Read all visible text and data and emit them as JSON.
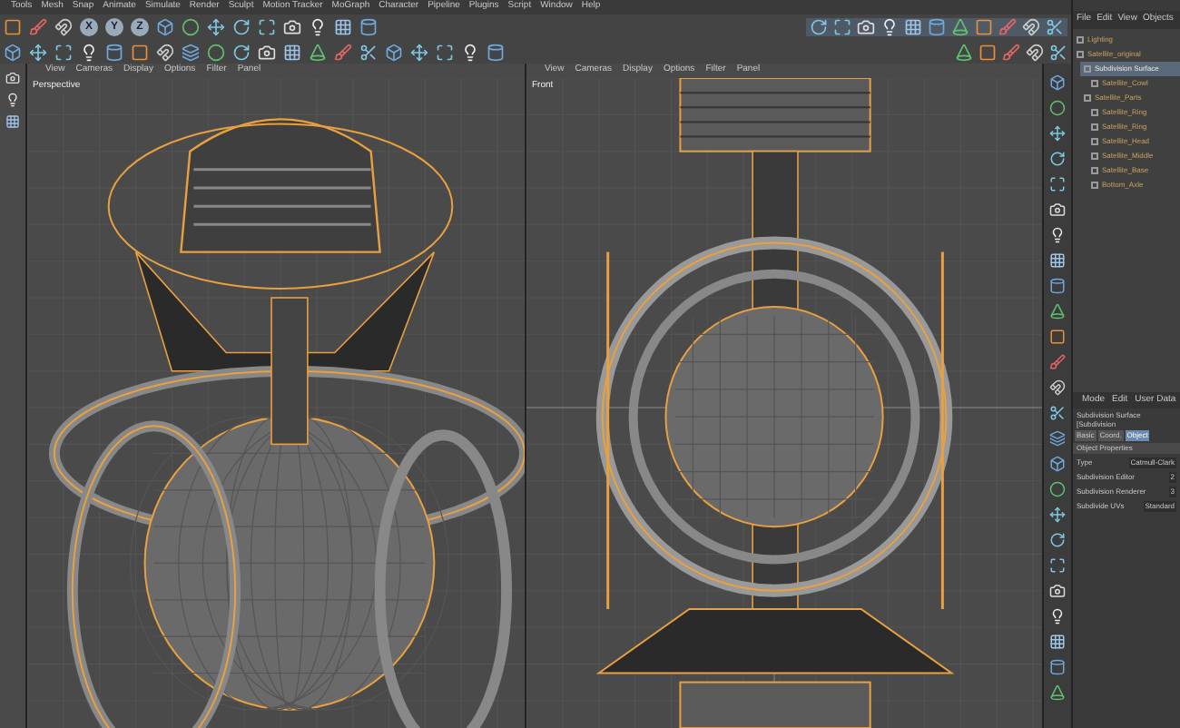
{
  "menu": [
    "Tools",
    "Mesh",
    "Snap",
    "Animate",
    "Simulate",
    "Render",
    "Sculpt",
    "Motion Tracker",
    "MoGraph",
    "Character",
    "Pipeline",
    "Plugins",
    "Script",
    "Window",
    "Help"
  ],
  "axis_buttons": [
    {
      "label": "X",
      "selected": true
    },
    {
      "label": "Y",
      "selected": true
    },
    {
      "label": "Z",
      "selected": true
    }
  ],
  "viewports": [
    {
      "menu": [
        "View",
        "Cameras",
        "Display",
        "Options",
        "Filter",
        "Panel"
      ],
      "label": "Perspective",
      "kind": "perspective"
    },
    {
      "menu": [
        "View",
        "Cameras",
        "Display",
        "Options",
        "Filter",
        "Panel"
      ],
      "label": "Front",
      "kind": "front"
    }
  ],
  "objects": {
    "menu": [
      "File",
      "Edit",
      "View",
      "Objects"
    ],
    "tree": [
      {
        "name": "Lighting",
        "selected": false
      },
      {
        "name": "Satellite_original",
        "selected": false,
        "children": [
          {
            "name": "Subdivision Surface",
            "selected": true,
            "children": [
              {
                "name": "Satellite_Cowl",
                "selected": false
              }
            ]
          },
          {
            "name": "Satellite_Parts",
            "selected": false,
            "children": [
              {
                "name": "Satellite_Ring",
                "selected": false
              },
              {
                "name": "Satellite_Ring",
                "selected": false
              },
              {
                "name": "Satellite_Head",
                "selected": false
              },
              {
                "name": "Satellite_Middle",
                "selected": false
              },
              {
                "name": "Satellite_Base",
                "selected": false
              },
              {
                "name": "Bottom_Axle",
                "selected": false
              }
            ]
          }
        ]
      }
    ]
  },
  "attributes": {
    "menu": [
      "Mode",
      "Edit",
      "User Data"
    ],
    "title": "Subdivision Surface [Subdivision",
    "tabs": [
      {
        "label": "Basic",
        "selected": false
      },
      {
        "label": "Coord.",
        "selected": false
      },
      {
        "label": "Object",
        "selected": true
      }
    ],
    "section": "Object Properties",
    "fields": [
      {
        "label": "Type",
        "value": "Catmull-Clark"
      },
      {
        "label": "Subdivision Editor",
        "value": "2"
      },
      {
        "label": "Subdivision Renderer",
        "value": "3"
      },
      {
        "label": "Subdivide UVs",
        "value": "Standard"
      }
    ]
  }
}
